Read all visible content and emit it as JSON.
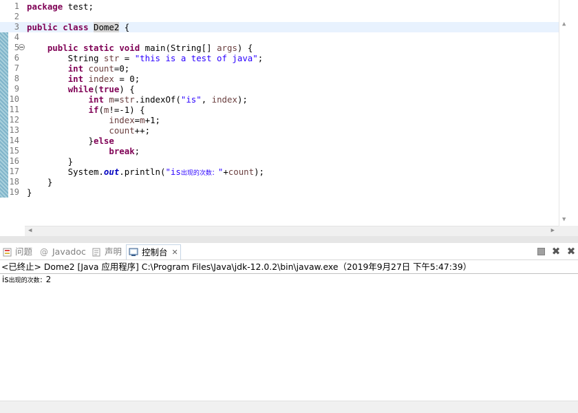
{
  "editor": {
    "lines": [
      {
        "num": "1",
        "segs": [
          {
            "t": "package",
            "c": "kw"
          },
          {
            "t": " test;"
          }
        ]
      },
      {
        "num": "2",
        "segs": []
      },
      {
        "num": "3",
        "current": true,
        "segs": [
          {
            "t": "public",
            "c": "kw"
          },
          {
            "t": " "
          },
          {
            "t": "class",
            "c": "kw"
          },
          {
            "t": " "
          },
          {
            "t": "Dome2",
            "c": "occ"
          },
          {
            "t": " {"
          }
        ]
      },
      {
        "num": "4",
        "segs": []
      },
      {
        "num": "5",
        "fold": true,
        "segs": [
          {
            "t": "    "
          },
          {
            "t": "public",
            "c": "kw"
          },
          {
            "t": " "
          },
          {
            "t": "static",
            "c": "kw"
          },
          {
            "t": " "
          },
          {
            "t": "void",
            "c": "kw"
          },
          {
            "t": " main(String[] "
          },
          {
            "t": "args",
            "c": "var"
          },
          {
            "t": ") {"
          }
        ]
      },
      {
        "num": "6",
        "segs": [
          {
            "t": "        String "
          },
          {
            "t": "str",
            "c": "var"
          },
          {
            "t": " = "
          },
          {
            "t": "\"this is a test of java\"",
            "c": "str"
          },
          {
            "t": ";"
          }
        ]
      },
      {
        "num": "7",
        "segs": [
          {
            "t": "        "
          },
          {
            "t": "int",
            "c": "kw"
          },
          {
            "t": " "
          },
          {
            "t": "count",
            "c": "var"
          },
          {
            "t": "=0;"
          }
        ]
      },
      {
        "num": "8",
        "segs": [
          {
            "t": "        "
          },
          {
            "t": "int",
            "c": "kw"
          },
          {
            "t": " "
          },
          {
            "t": "index",
            "c": "var"
          },
          {
            "t": " = 0;"
          }
        ]
      },
      {
        "num": "9",
        "segs": [
          {
            "t": "        "
          },
          {
            "t": "while",
            "c": "kw"
          },
          {
            "t": "("
          },
          {
            "t": "true",
            "c": "kw"
          },
          {
            "t": ") {"
          }
        ]
      },
      {
        "num": "10",
        "segs": [
          {
            "t": "            "
          },
          {
            "t": "int",
            "c": "kw"
          },
          {
            "t": " "
          },
          {
            "t": "m",
            "c": "var"
          },
          {
            "t": "="
          },
          {
            "t": "str",
            "c": "var"
          },
          {
            "t": ".indexOf("
          },
          {
            "t": "\"is\"",
            "c": "str"
          },
          {
            "t": ", "
          },
          {
            "t": "index",
            "c": "var"
          },
          {
            "t": ");"
          }
        ]
      },
      {
        "num": "11",
        "segs": [
          {
            "t": "            "
          },
          {
            "t": "if",
            "c": "kw"
          },
          {
            "t": "("
          },
          {
            "t": "m",
            "c": "var"
          },
          {
            "t": "!=-1) {"
          }
        ]
      },
      {
        "num": "12",
        "segs": [
          {
            "t": "                "
          },
          {
            "t": "index",
            "c": "var"
          },
          {
            "t": "="
          },
          {
            "t": "m",
            "c": "var"
          },
          {
            "t": "+1;"
          }
        ]
      },
      {
        "num": "13",
        "segs": [
          {
            "t": "                "
          },
          {
            "t": "count",
            "c": "var"
          },
          {
            "t": "++;"
          }
        ]
      },
      {
        "num": "14",
        "segs": [
          {
            "t": "            }"
          },
          {
            "t": "else",
            "c": "kw"
          }
        ]
      },
      {
        "num": "15",
        "segs": [
          {
            "t": "                "
          },
          {
            "t": "break",
            "c": "kw"
          },
          {
            "t": ";"
          }
        ]
      },
      {
        "num": "16",
        "segs": [
          {
            "t": "        }"
          }
        ]
      },
      {
        "num": "17",
        "segs": [
          {
            "t": "        System."
          },
          {
            "t": "out",
            "c": "sfld"
          },
          {
            "t": ".println("
          },
          {
            "t": "\"is",
            "c": "str"
          },
          {
            "t": "出现的次数：",
            "c": "str cjk"
          },
          {
            "t": "\"",
            "c": "str"
          },
          {
            "t": "+"
          },
          {
            "t": "count",
            "c": "var"
          },
          {
            "t": ");"
          }
        ]
      },
      {
        "num": "18",
        "segs": [
          {
            "t": "    }"
          }
        ]
      },
      {
        "num": "19",
        "segs": [
          {
            "t": "}"
          }
        ]
      }
    ]
  },
  "tabs": {
    "problems": "问题",
    "javadoc": "Javadoc",
    "declaration": "声明",
    "console": "控制台"
  },
  "console": {
    "header": "<已终止> Dome2 [Java 应用程序] C:\\Program Files\\Java\\jdk-12.0.2\\bin\\javaw.exe（2019年9月27日 下午5:47:39）",
    "output_prefix": "is",
    "output_cjk": "出现的次数：",
    "output_value": "2"
  }
}
